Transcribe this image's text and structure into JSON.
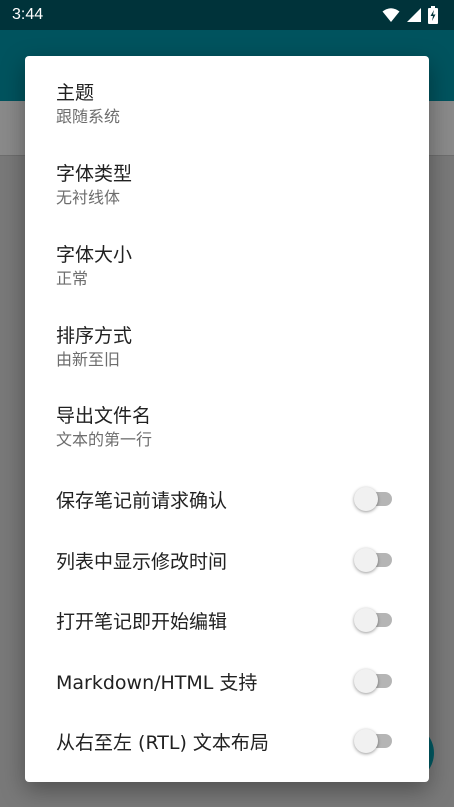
{
  "status_bar": {
    "time": "3:44",
    "icons": [
      "wifi-icon",
      "signal-icon",
      "battery-charging-icon"
    ]
  },
  "dialog": {
    "preferences": [
      {
        "title": "主题",
        "summary": "跟随系统"
      },
      {
        "title": "字体类型",
        "summary": "无衬线体"
      },
      {
        "title": "字体大小",
        "summary": "正常"
      },
      {
        "title": "排序方式",
        "summary": "由新至旧"
      },
      {
        "title": "导出文件名",
        "summary": "文本的第一行"
      }
    ],
    "switches": [
      {
        "label": "保存笔记前请求确认",
        "enabled": false
      },
      {
        "label": "列表中显示修改时间",
        "enabled": false
      },
      {
        "label": "打开笔记即开始编辑",
        "enabled": false
      },
      {
        "label": "Markdown/HTML 支持",
        "enabled": false
      },
      {
        "label": "从右至左 (RTL) 文本布局",
        "enabled": false
      }
    ]
  },
  "colors": {
    "status_bar": "#00333a",
    "app_bar": "#00535e",
    "scrim": "#7a7a7a",
    "switch_off_track": "#b5b5b5",
    "switch_off_thumb": "#f1f1f1"
  }
}
